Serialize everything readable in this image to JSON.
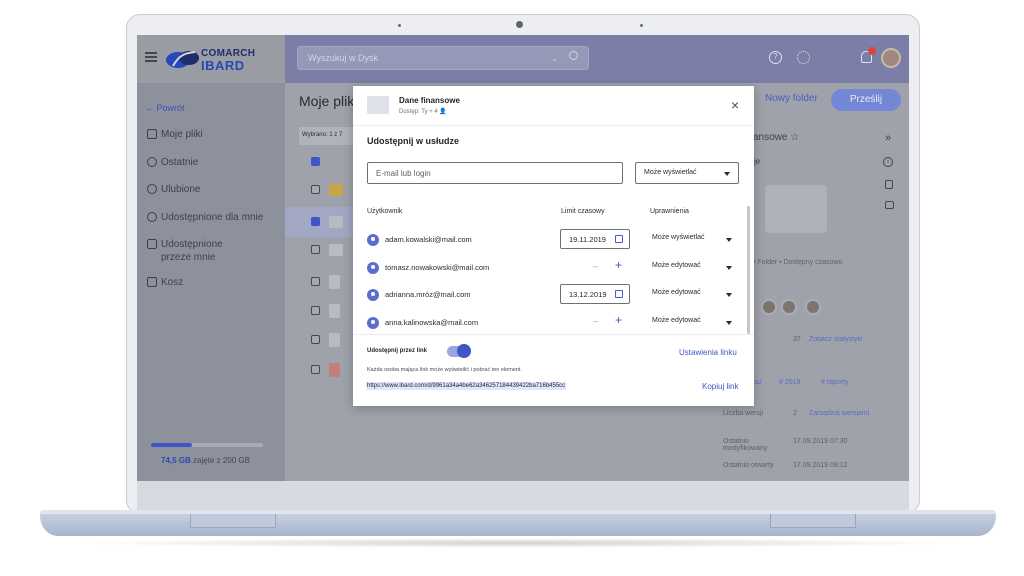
{
  "app": {
    "logo_line1": "COMARCH",
    "logo_line2": "IBARD",
    "search_placeholder": "Wyszukuj w Dysk",
    "storage": {
      "used": "74,5 GB",
      "rest": " zajęte z 200 GB",
      "fraction": 0.37
    }
  },
  "sidebar": {
    "back": "Powrót",
    "items": [
      {
        "label": "Moje pliki",
        "icon": "folder-icon"
      },
      {
        "label": "Ostatnie",
        "icon": "clock-icon"
      },
      {
        "label": "Ulubione",
        "icon": "star-icon"
      },
      {
        "label": "Udostępnione dla mnie",
        "icon": "shared-with-me-icon"
      },
      {
        "label": "Udostępnione",
        "label2": "przeze mnie",
        "icon": "shared-by-me-icon"
      },
      {
        "label": "Kosz",
        "icon": "trash-icon"
      }
    ]
  },
  "main": {
    "title": "Moje pliki",
    "selected": "Wybrano: 1 z 7",
    "new_folder": "Nowy folder",
    "send": "Prześlij"
  },
  "right_panel": {
    "title_fragment": "ansowe ☆",
    "folder_meta": "• Folder • Dostępny czasowo",
    "count": "37",
    "stats_link": "Zobacz statystyki",
    "tags": [
      "iaż",
      "# 2019",
      "# raporty"
    ],
    "versions_label": "Liczba wersji",
    "versions_value": "2",
    "versions_link": "Zarządzaj wersjami",
    "modified_label": "Ostatnio modyfikowany",
    "modified_value": "17.09.2019 07:30",
    "opened_label": "Ostatnio otwarty",
    "opened_value": "17.09.2019 09:12"
  },
  "modal": {
    "file_name": "Dane finansowe",
    "access": "Dostęp: Ty + 4",
    "heading": "Udostępnij w usłudze",
    "email_placeholder": "E-mail lub login",
    "default_permission": "Może wyświetlać",
    "col_user": "Użytkownik",
    "col_limit": "Limit czasowy",
    "col_perm": "Uprawnienia",
    "users": [
      {
        "email": "adam.kowalski@mail.com",
        "limit": "19.11.2019",
        "permission": "Może wyświetlać"
      },
      {
        "email": "tomasz.nowakowski@mail.com",
        "limit": "-- ",
        "permission": "Może edytować"
      },
      {
        "email": "adrianna.mróz@mail.com",
        "limit": "13.12.2019",
        "permission": "Może edytować"
      },
      {
        "email": "anna.kalinowska@mail.com",
        "limit": "-- ",
        "permission": "Może edytować"
      }
    ],
    "share_link_label": "Udostępnij przez link",
    "link_settings": "Ustawienia linku",
    "link_desc": "Każda osoba mająca link może wyświetlić i pobrać ten element.",
    "link_url": "https://www.ibard.com/d/9961a34a4be62a346257184439422ba716b455cc",
    "copy_link": "Kopiuj link"
  }
}
